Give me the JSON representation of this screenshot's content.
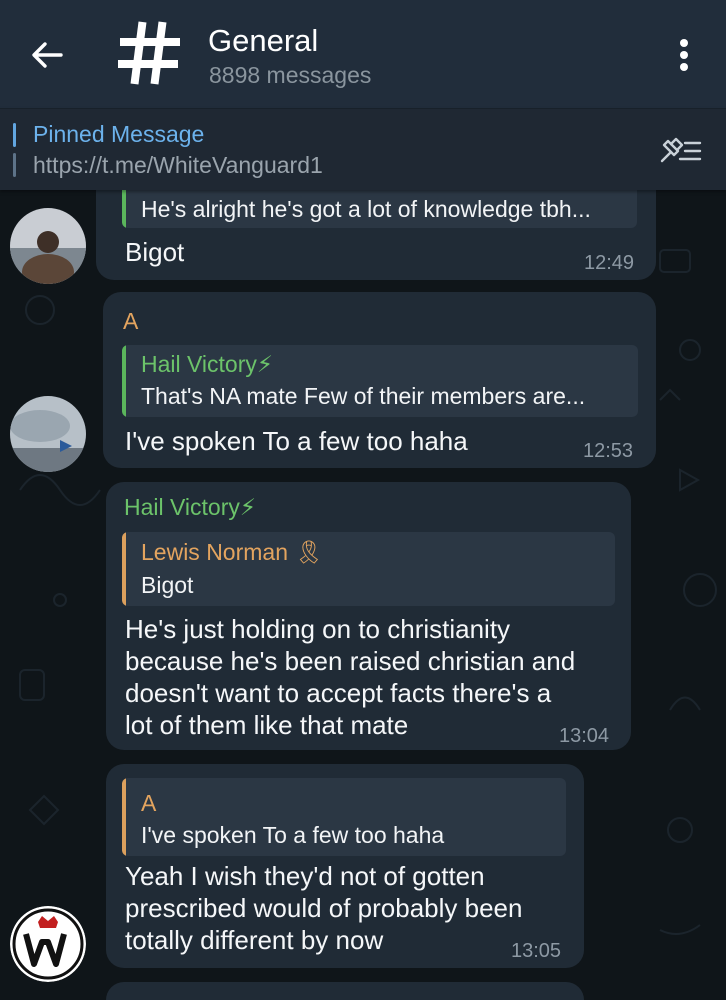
{
  "header": {
    "title": "General",
    "subtitle": "8898 messages"
  },
  "pinned": {
    "title": "Pinned Message",
    "link": "https://t.me/WhiteVanguard1"
  },
  "colors": {
    "header_bg": "#212d3b",
    "bubble_bg": "#202b36",
    "reply_bg": "#2b3744",
    "accent_blue": "#6cb2ec",
    "name_green": "#6cc36a",
    "name_orange": "#e3a45f",
    "bar_green": "#5bb65c",
    "bar_orange": "#dca05d"
  },
  "messages": [
    {
      "reply_text": "He's alright he's got a lot of knowledge tbh...",
      "text": "Bigot",
      "time": "12:49"
    },
    {
      "sender": "A",
      "reply_name": "Hail Victory⚡",
      "reply_text": "That's NA mate  Few of their members are...",
      "text": "I've spoken To a few too haha",
      "time": "12:53"
    },
    {
      "sender": "Hail Victory⚡",
      "reply_name": "Lewis Norman 🎗",
      "reply_text": "Bigot",
      "text_lines": [
        "He's just holding on to christianity",
        "because he's been raised christian and",
        "doesn't want to accept facts there's a",
        "lot of them like that mate"
      ],
      "time": "13:04"
    },
    {
      "reply_name": "A",
      "reply_text": "I've spoken To a few too haha",
      "text_lines": [
        "Yeah I wish they'd not of gotten",
        "prescribed would of probably been",
        "totally different by now"
      ],
      "time": "13:05"
    }
  ],
  "icons": {
    "back": "arrow-left-icon",
    "channel": "hash-icon",
    "menu": "vertical-dots-icon",
    "pin_list": "pin-list-icon"
  }
}
